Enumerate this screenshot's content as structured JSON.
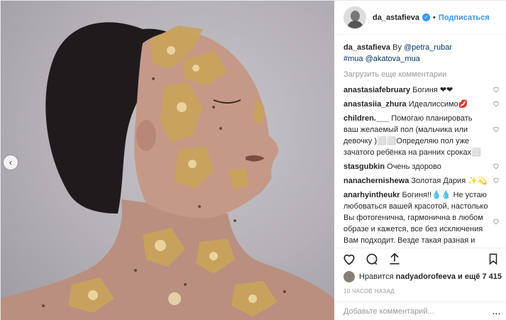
{
  "post": {
    "username": "da_astafieva",
    "follow_label": "Подписаться",
    "caption": {
      "username": "da_astafieva",
      "by_text": "By",
      "mention_1": "@petra_rubar",
      "hashtag": "#mua",
      "mention_2": "@akatova_mua"
    },
    "load_more_label": "Загрузить еще комментарии",
    "comments": [
      {
        "user": "anastasiafebruary",
        "text": "Богиня ❤❤"
      },
      {
        "user": "anastasiia_zhura",
        "text": "Идеалиссимо💋"
      },
      {
        "user": "children.___",
        "text": "Помогаю планировать ваш желаемый пол (мальчика или девочку )⬜⬜Определяю пол уже зачатого ребёнка на ранних сроках⬜"
      },
      {
        "user": "stasgubkin",
        "text": "Очень здорово"
      },
      {
        "user": "nanachernishewa",
        "text": "Золотая Дария ✨💫"
      },
      {
        "user": "anarhyintheukr",
        "text": "Богиня!!💧💧 Не устаю любоваться вашей красотой, настолько Вы фотогеничнa, гармонична в любом образе и кажется, все без исключения Вам подходит. Везде такая разная и такая узнаваемая"
      }
    ],
    "likes_text": "Нравится nadyadorofeeva и ещё 7 415",
    "likes_prefix": "Нравится",
    "likes_user": "nadyadorofeeva",
    "likes_suffix": "и ещё 7 415",
    "timestamp": "10 ЧАСОВ НАЗАД",
    "comment_placeholder": "Добавьте комментарий...",
    "more_label": "..."
  },
  "colors": {
    "link_blue": "#3897f0",
    "muted_gray": "#999999",
    "text": "#262626"
  }
}
